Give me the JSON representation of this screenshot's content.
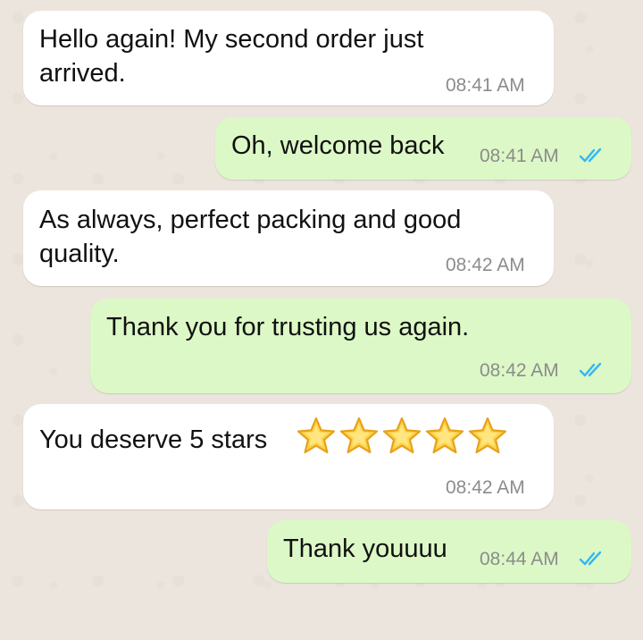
{
  "messages": [
    {
      "direction": "incoming",
      "text": "Hello again! My second order just\narrived.",
      "time": "08:41 AM"
    },
    {
      "direction": "outgoing",
      "text": "Oh, welcome back",
      "time": "08:41 AM",
      "status": "read"
    },
    {
      "direction": "incoming",
      "text": "As always, perfect packing and good\nquality.",
      "time": "08:42 AM"
    },
    {
      "direction": "outgoing",
      "text": "Thank you for trusting us again.",
      "time": "08:42 AM",
      "status": "read"
    },
    {
      "direction": "incoming",
      "text": "You deserve 5 stars",
      "emoji": "star-emoji",
      "emoji_count": 5,
      "time": "08:42 AM"
    },
    {
      "direction": "outgoing",
      "text": "Thank youuuu",
      "time": "08:44 AM",
      "status": "read"
    }
  ],
  "colors": {
    "incoming_bubble": "#ffffff",
    "outgoing_bubble": "#dcf8c6",
    "read_ticks": "#34b7f1",
    "timestamp": "#8c8c8c",
    "wallpaper": "#ece5dd"
  }
}
